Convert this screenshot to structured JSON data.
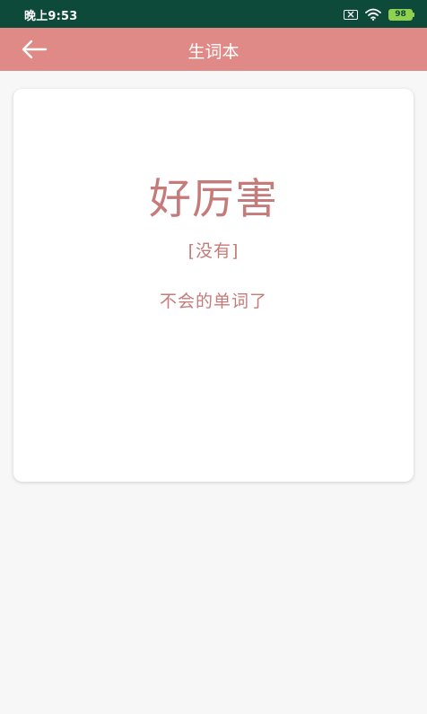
{
  "status_bar": {
    "time": "晚上9:53",
    "battery_level": "98",
    "icons": [
      "sim-icon",
      "wifi-icon",
      "battery-icon"
    ],
    "background": "#0e4a3a"
  },
  "app_bar": {
    "title": "生词本",
    "back_icon": "arrow-left-icon",
    "background": "#e08a88"
  },
  "card": {
    "word": "好厉害",
    "phonetic": "[没有]",
    "meaning": "不会的单词了",
    "text_color": "#c47b7a"
  }
}
